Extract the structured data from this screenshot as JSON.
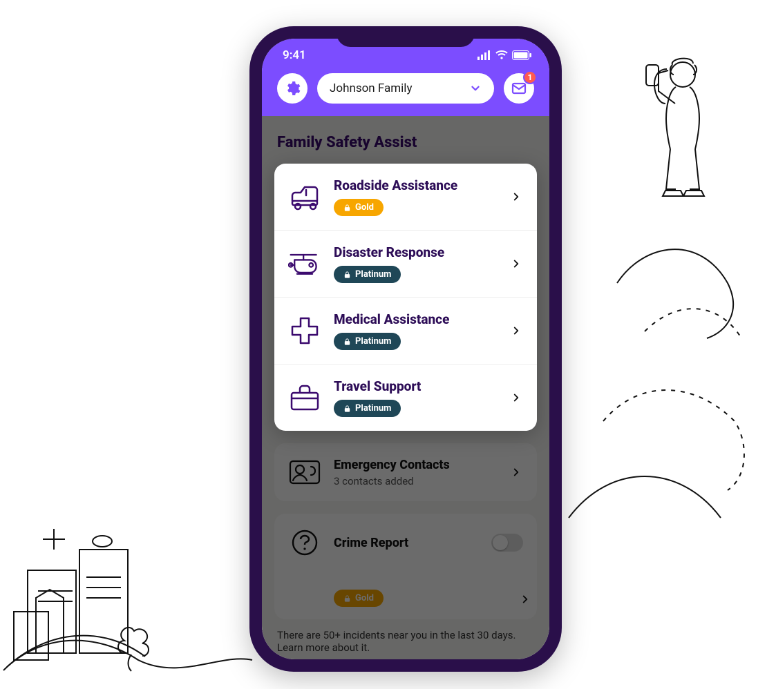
{
  "status": {
    "time": "9:41"
  },
  "header": {
    "family_label": "Johnson Family",
    "notifications_count": "1"
  },
  "page": {
    "title": "Family Safety Assist"
  },
  "assist_items": [
    {
      "title": "Roadside Assistance",
      "tier": "Gold",
      "tier_class": "tier-gold",
      "icon": "car-icon"
    },
    {
      "title": "Disaster Response",
      "tier": "Platinum",
      "tier_class": "tier-platinum",
      "icon": "heli-icon"
    },
    {
      "title": "Medical Assistance",
      "tier": "Platinum",
      "tier_class": "tier-platinum",
      "icon": "medical-icon"
    },
    {
      "title": "Travel Support",
      "tier": "Platinum",
      "tier_class": "tier-platinum",
      "icon": "travel-icon"
    }
  ],
  "emergency_contacts": {
    "title": "Emergency Contacts",
    "subtitle": "3 contacts added"
  },
  "crime_report": {
    "title": "Crime Report",
    "tier": "Gold",
    "tier_class": "tier-gold"
  },
  "incidents_note": "There are 50+ incidents near you in the last 30 days. Learn more about it."
}
